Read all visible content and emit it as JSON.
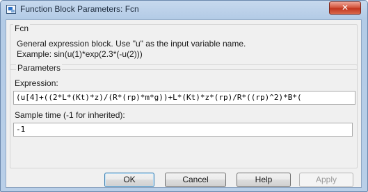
{
  "window": {
    "title": "Function Block Parameters: Fcn",
    "close_glyph": "✕",
    "icon": "simulink-block-icon"
  },
  "fcn_group": {
    "legend": "Fcn",
    "description_line1": "General expression block. Use \"u\" as the input variable name.",
    "description_line2": "Example: sin(u(1)*exp(2.3*(-u(2)))"
  },
  "parameters_group": {
    "legend": "Parameters",
    "expression_label": "Expression:",
    "expression_value": "(u[4]+((2*L*(Kt)*z)/(R*(rp)*m*g))+L*(Kt)*z*(rp)/R*((rp)^2)*B*(",
    "sample_time_label": "Sample time (-1 for inherited):",
    "sample_time_value": "-1"
  },
  "buttons": {
    "ok": "OK",
    "cancel": "Cancel",
    "help": "Help",
    "apply": "Apply"
  },
  "colors": {
    "close_button": "#c94a30",
    "frame": "#b9cfe8",
    "client_background": "#f0f0f0"
  }
}
